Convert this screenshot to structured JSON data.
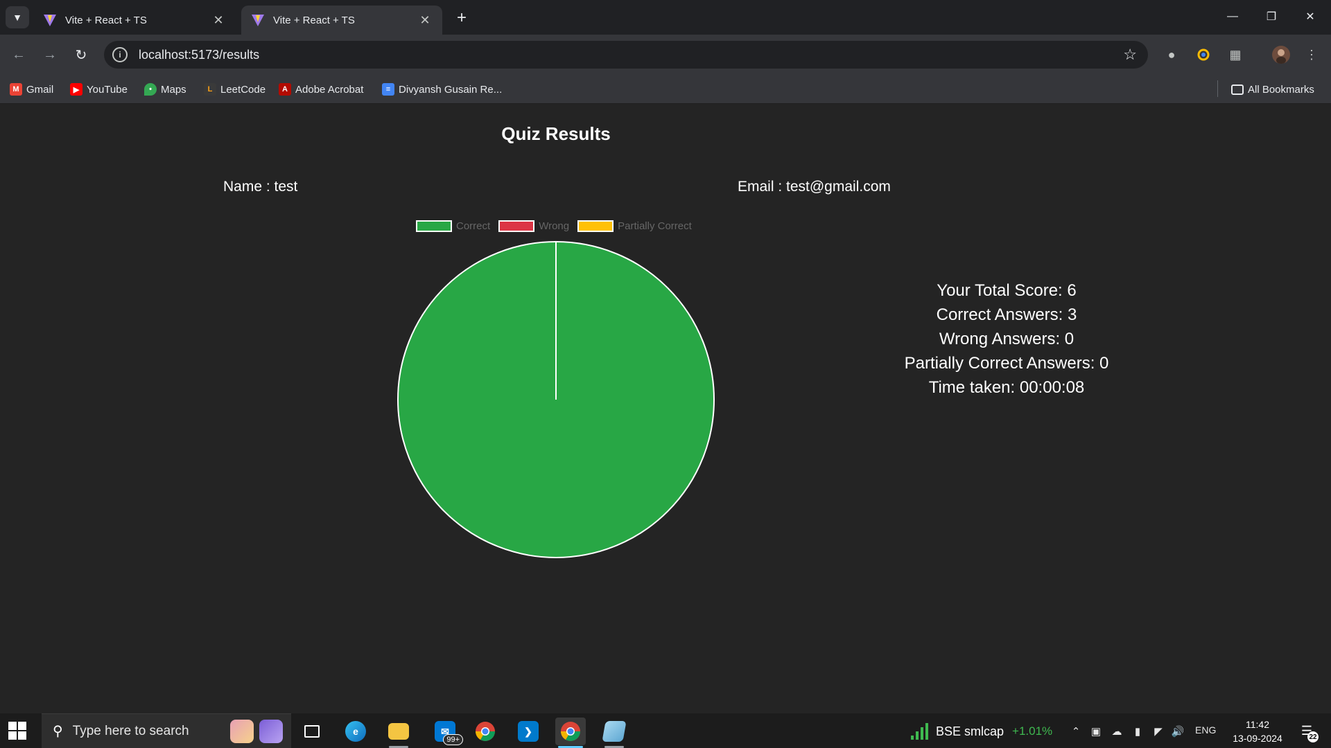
{
  "browser": {
    "tabs": [
      {
        "title": "Vite + React + TS",
        "active": false
      },
      {
        "title": "Vite + React + TS",
        "active": true
      }
    ],
    "url": "localhost:5173/results",
    "bookmarks": [
      {
        "label": "Gmail",
        "icon": "gmail-icon",
        "color": "#ea4335"
      },
      {
        "label": "YouTube",
        "icon": "youtube-icon",
        "color": "#ff0000"
      },
      {
        "label": "Maps",
        "icon": "maps-icon",
        "color": "#34a853"
      },
      {
        "label": "LeetCode",
        "icon": "leetcode-icon",
        "color": "#ffa116"
      },
      {
        "label": "Adobe Acrobat",
        "icon": "acrobat-icon",
        "color": "#b30b00"
      },
      {
        "label": "Divyansh Gusain Re...",
        "icon": "docs-icon",
        "color": "#4285f4"
      }
    ],
    "all_bookmarks_label": "All Bookmarks"
  },
  "page": {
    "title": "Quiz Results",
    "name_line": "Name : test",
    "email_line": "Email : test@gmail.com",
    "stats": {
      "total_score": "Your Total Score: 6",
      "correct": "Correct Answers: 3",
      "wrong": "Wrong Answers: 0",
      "partial": "Partially Correct Answers: 0",
      "time": "Time taken: 00:00:08"
    }
  },
  "chart_data": {
    "type": "pie",
    "categories": [
      "Correct",
      "Wrong",
      "Partially Correct"
    ],
    "values": [
      3,
      0,
      0
    ],
    "colors": [
      "#28a745",
      "#dc3545",
      "#ffc107"
    ],
    "legend": "top"
  },
  "taskbar": {
    "search_placeholder": "Type here to search",
    "mail_badge": "99+",
    "ticker_name": "BSE smlcap",
    "ticker_change": "+1.01%",
    "language": "ENG",
    "time": "11:42",
    "date": "13-09-2024",
    "notification_count": "22"
  }
}
